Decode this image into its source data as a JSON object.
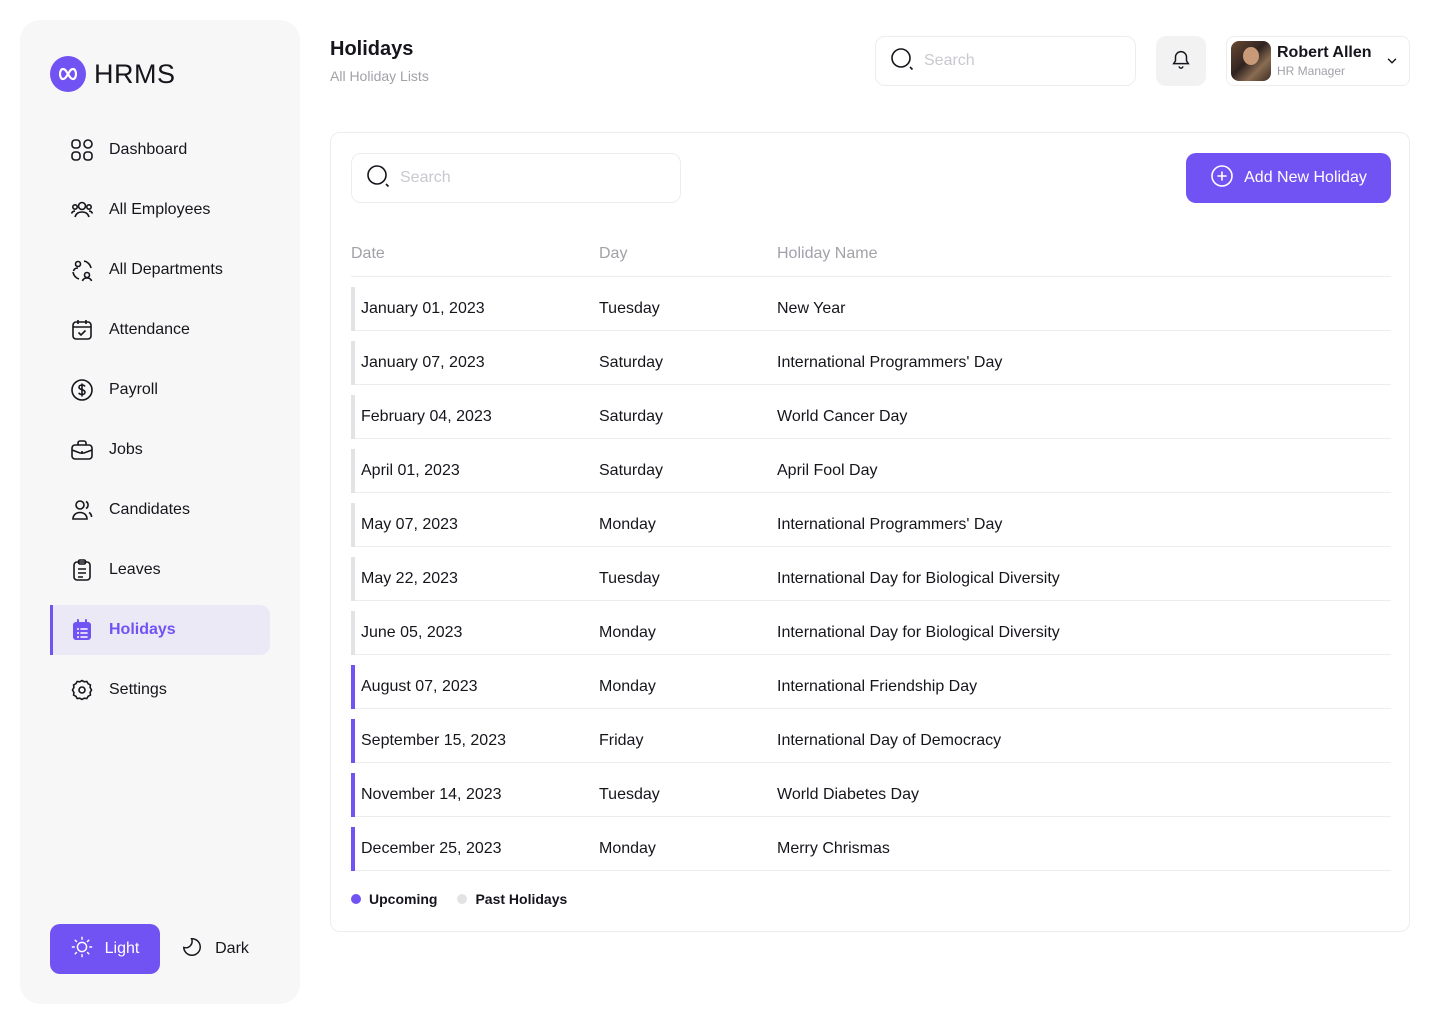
{
  "brand": {
    "name": "HRMS"
  },
  "sidebar": {
    "items": [
      {
        "label": "Dashboard",
        "icon": "dashboard-icon"
      },
      {
        "label": "All Employees",
        "icon": "users-icon"
      },
      {
        "label": "All Departments",
        "icon": "departments-icon"
      },
      {
        "label": "Attendance",
        "icon": "calendar-check-icon"
      },
      {
        "label": "Payroll",
        "icon": "dollar-circle-icon"
      },
      {
        "label": "Jobs",
        "icon": "briefcase-icon"
      },
      {
        "label": "Candidates",
        "icon": "candidates-icon"
      },
      {
        "label": "Leaves",
        "icon": "clipboard-icon"
      },
      {
        "label": "Holidays",
        "icon": "calendar-list-icon",
        "active": true
      },
      {
        "label": "Settings",
        "icon": "gear-icon"
      }
    ],
    "theme": {
      "light_label": "Light",
      "dark_label": "Dark",
      "selected": "Light"
    }
  },
  "header": {
    "title": "Holidays",
    "subtitle": "All Holiday Lists",
    "search_placeholder": "Search",
    "user": {
      "name": "Robert Allen",
      "role": "HR Manager"
    }
  },
  "holidays": {
    "search_placeholder": "Search",
    "add_button_label": "Add New Holiday",
    "columns": {
      "date": "Date",
      "day": "Day",
      "name": "Holiday Name"
    },
    "rows": [
      {
        "date": "January 01, 2023",
        "day": "Tuesday",
        "name": "New Year",
        "status": "past"
      },
      {
        "date": "January 07, 2023",
        "day": "Saturday",
        "name": "International Programmers' Day",
        "status": "past"
      },
      {
        "date": "February 04, 2023",
        "day": "Saturday",
        "name": "World Cancer Day",
        "status": "past"
      },
      {
        "date": "April 01, 2023",
        "day": "Saturday",
        "name": "April Fool Day",
        "status": "past"
      },
      {
        "date": "May 07, 2023",
        "day": "Monday",
        "name": "International Programmers' Day",
        "status": "past"
      },
      {
        "date": "May 22, 2023",
        "day": "Tuesday",
        "name": "International Day for Biological Diversity",
        "status": "past"
      },
      {
        "date": "June 05, 2023",
        "day": "Monday",
        "name": "International Day for Biological Diversity",
        "status": "past"
      },
      {
        "date": "August 07, 2023",
        "day": "Monday",
        "name": "International Friendship Day",
        "status": "upcoming"
      },
      {
        "date": "September 15, 2023",
        "day": "Friday",
        "name": "International Day of Democracy",
        "status": "upcoming"
      },
      {
        "date": "November 14, 2023",
        "day": "Tuesday",
        "name": "World Diabetes Day",
        "status": "upcoming"
      },
      {
        "date": "December 25, 2023",
        "day": "Monday",
        "name": "Merry Chrismas",
        "status": "upcoming"
      }
    ],
    "legend": {
      "upcoming": "Upcoming",
      "past": "Past Holidays"
    }
  },
  "colors": {
    "accent": "#7152f3",
    "past_marker": "#e3e3e6",
    "text": "#16151c",
    "muted": "#a2a1a8"
  }
}
